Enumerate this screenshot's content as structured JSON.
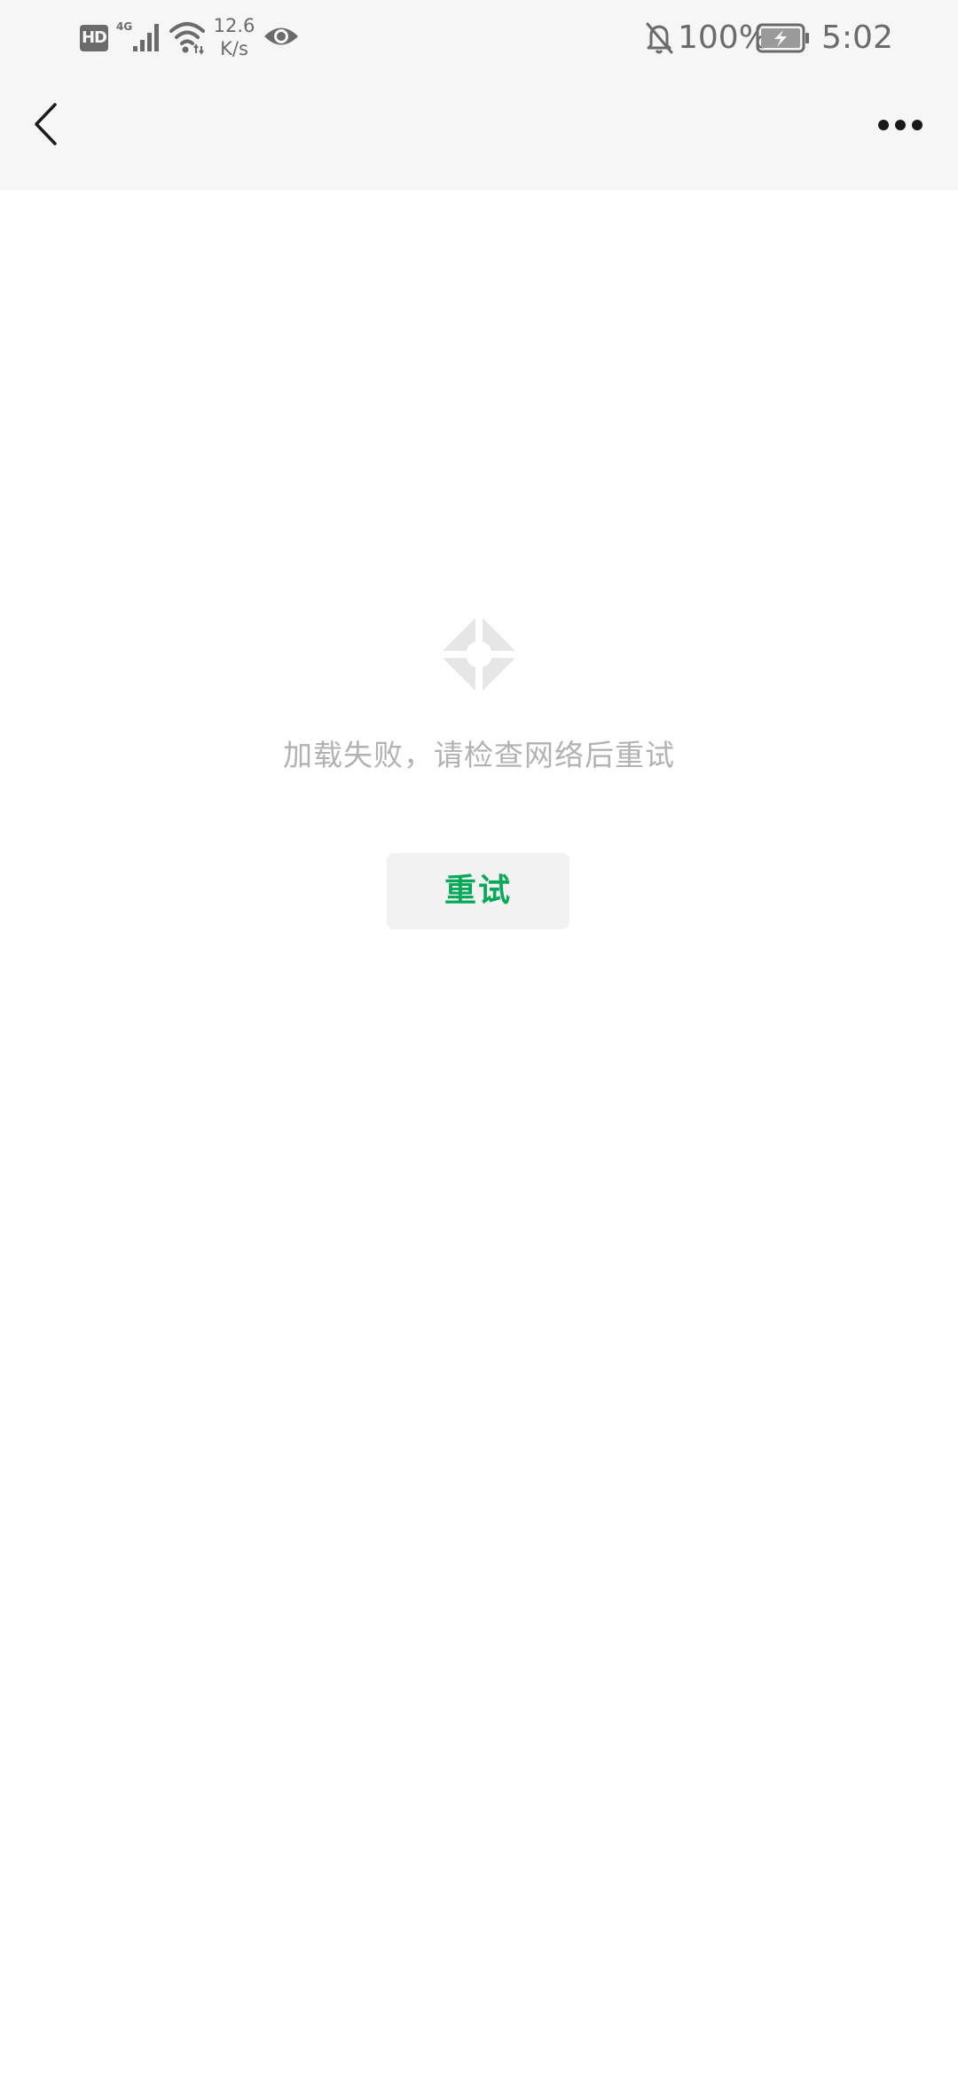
{
  "status_bar": {
    "hd_label": "HD",
    "network_type": "4G",
    "net_speed_value": "12.6",
    "net_speed_unit": "K/s",
    "battery_percent": "100%",
    "time": "5:02",
    "icons": [
      "hd-icon",
      "signal-4g-icon",
      "wifi-icon",
      "eye-icon",
      "bell-muted-icon",
      "battery-charging-icon"
    ]
  },
  "nav": {
    "back_icon": "chevron-left-icon",
    "more_icon": "more-dots-icon"
  },
  "error": {
    "icon": "load-failed-icon",
    "message": "加载失败，请检查网络后重试",
    "retry_label": "重试"
  },
  "colors": {
    "top_bar_background": "#f6f6f6",
    "page_background": "#ffffff",
    "message_text": "#b2b2b2",
    "retry_text": "#07a85a",
    "retry_background": "#f2f2f2"
  }
}
